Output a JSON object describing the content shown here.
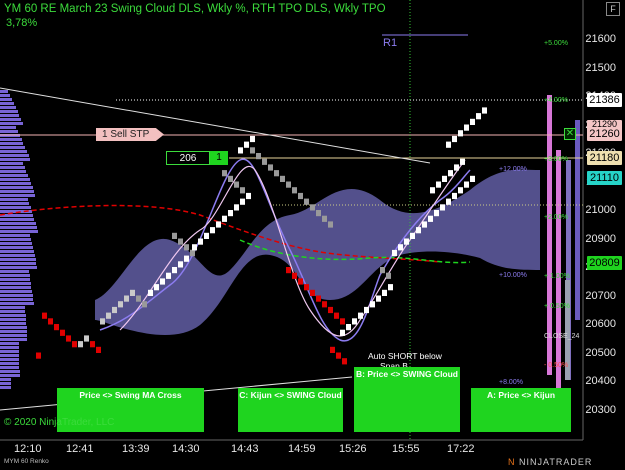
{
  "header": {
    "title": "YM 60 RE March 23  Swing Cloud DLS, Wkly %, RTH TPO DLS, Wkly TPO",
    "percent": "3,78%"
  },
  "price_axis": [
    "21600",
    "21500",
    "21400",
    "21300",
    "21200",
    "21100",
    "21000",
    "20900",
    "20800",
    "20700",
    "20600",
    "20500",
    "20400",
    "20300"
  ],
  "time_axis": [
    "12:10",
    "12:41",
    "13:39",
    "14:30",
    "14:43",
    "14:59",
    "15:26",
    "15:55",
    "17:22"
  ],
  "price_markers": {
    "last": "21386",
    "partial": "21290",
    "sell_stop": "21260",
    "qty_level": "21180",
    "cyan_level": "21110",
    "green_level": "20809"
  },
  "order": {
    "sell_stp_label": "1 Sell STP",
    "qty": "206",
    "count": "1",
    "close_icon": "close-x-icon"
  },
  "percent_labels": [
    {
      "text": "+5.00%",
      "color": "#3cdc3c"
    },
    {
      "text": "+4.00%",
      "color": "#3cdc3c"
    },
    {
      "text": "+3.00%",
      "color": "#3cdc3c"
    },
    {
      "text": "+12.00%",
      "color": "#8c7cf0"
    },
    {
      "text": "+2.00%",
      "color": "#3cdc3c"
    },
    {
      "text": "+10.00%",
      "color": "#8c7cf0"
    },
    {
      "text": "+ 1.00%",
      "color": "#3cdc3c"
    },
    {
      "text": "+ 0.50%",
      "color": "#3cdc3c"
    },
    {
      "text": "CLOSE_24",
      "color": "#dddddd"
    },
    {
      "text": "- 0.50%",
      "color": "#ff5050"
    },
    {
      "text": "+8.00%",
      "color": "#8c7cf0"
    }
  ],
  "annotations": {
    "r1": "R1",
    "auto_short": "Auto SHORT below",
    "span_b": "Span B"
  },
  "signal_boxes": [
    {
      "label": "Price <> Swing MA Cross"
    },
    {
      "label": "C: Kijun <> SWING Cloud"
    },
    {
      "label": "B: Price <> SWING Cloud"
    },
    {
      "label": "A: Price <> Kijun"
    }
  ],
  "footer": {
    "copyright": "© 2020 NinjaTrader, LLC",
    "instrument": "MYM 60 Renko",
    "logo_prefix": "N",
    "logo_text": "NINJATRADER"
  },
  "colors": {
    "up_brick": "#ffffff",
    "down_brick": "#e00000",
    "neutral_brick": "#9a9a9a",
    "cloud": "#6a66b4",
    "signal_green": "#1fd41f",
    "text_green": "#3cdc3c",
    "purple": "#8c7cf0"
  }
}
